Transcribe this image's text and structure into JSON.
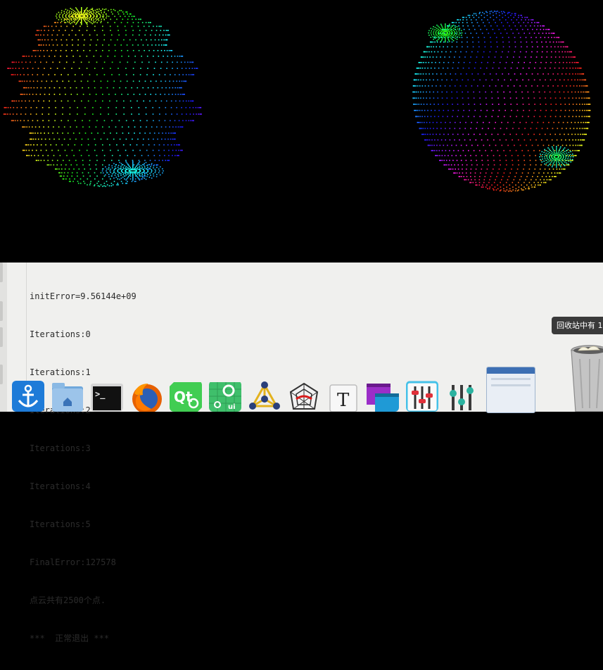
{
  "viewer": {
    "name": "point-cloud-viewer"
  },
  "terminal": {
    "lines": [
      "initError=9.56144e+09",
      "Iterations:0",
      "Iterations:1",
      "Iterations:2",
      "Iterations:3",
      "Iterations:4",
      "Iterations:5",
      "FinalError:127578",
      "点云共有2500个点.",
      "***  正常退出 ***"
    ]
  },
  "toast": {
    "text": "回收站中有 1"
  },
  "dock": {
    "items": [
      {
        "name": "anchor-app-icon"
      },
      {
        "name": "home-folder-icon"
      },
      {
        "name": "terminal-icon"
      },
      {
        "name": "firefox-icon"
      },
      {
        "name": "qt-creator-icon"
      },
      {
        "name": "qt-designer-icon"
      },
      {
        "name": "network-graph-icon"
      },
      {
        "name": "spider-web-icon"
      },
      {
        "name": "text-editor-icon"
      },
      {
        "name": "window-switcher-icon"
      },
      {
        "name": "mixer-sliders-icon"
      },
      {
        "name": "equalizer-icon"
      }
    ]
  }
}
